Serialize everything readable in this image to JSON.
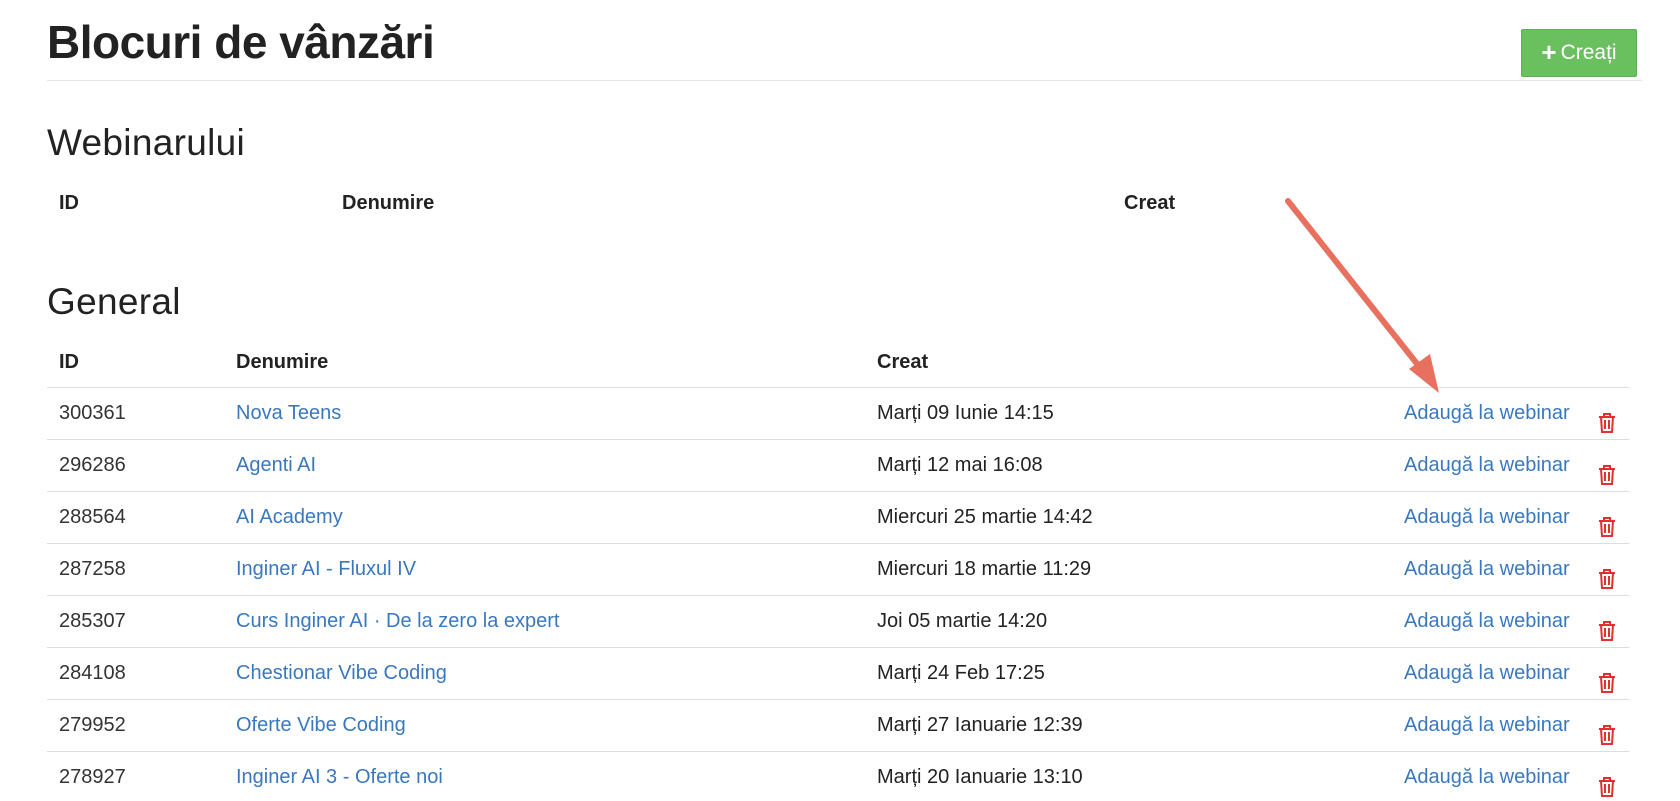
{
  "header": {
    "title": "Blocuri de vânzări",
    "create_label": "Creați"
  },
  "sections": {
    "webinar": {
      "title": "Webinarului",
      "columns": {
        "id": "ID",
        "name": "Denumire",
        "created": "Creat"
      }
    },
    "general": {
      "title": "General",
      "columns": {
        "id": "ID",
        "name": "Denumire",
        "created": "Creat"
      },
      "rows": [
        {
          "id": "300361",
          "name": "Nova Teens",
          "created": "Marți 09 Iunie 14:15",
          "action": "Adaugă la webinar"
        },
        {
          "id": "296286",
          "name": "Agenti AI",
          "created": "Marți 12 mai 16:08",
          "action": "Adaugă la webinar"
        },
        {
          "id": "288564",
          "name": "AI Academy",
          "created": "Miercuri 25 martie 14:42",
          "action": "Adaugă la webinar"
        },
        {
          "id": "287258",
          "name": "Inginer AI - Fluxul IV",
          "created": "Miercuri 18 martie 11:29",
          "action": "Adaugă la webinar"
        },
        {
          "id": "285307",
          "name": "Curs Inginer AI · De la zero la expert",
          "created": "Joi 05 martie 14:20",
          "action": "Adaugă la webinar"
        },
        {
          "id": "284108",
          "name": "Chestionar Vibe Coding",
          "created": "Marți 24 Feb 17:25",
          "action": "Adaugă la webinar"
        },
        {
          "id": "279952",
          "name": "Oferte Vibe Coding",
          "created": "Marți 27 Ianuarie 12:39",
          "action": "Adaugă la webinar"
        },
        {
          "id": "278927",
          "name": "Inginer AI 3 - Oferte noi",
          "created": "Marți 20 Ianuarie 13:10",
          "action": "Adaugă la webinar"
        }
      ]
    }
  },
  "icons": {
    "create": "plus-icon",
    "delete": "trash-icon",
    "annotation": "arrow-annotation"
  },
  "colors": {
    "primary_link": "#3a78bd",
    "create_button": "#6abf5e",
    "delete_icon": "#e0302f",
    "arrow": "#e8705f"
  }
}
